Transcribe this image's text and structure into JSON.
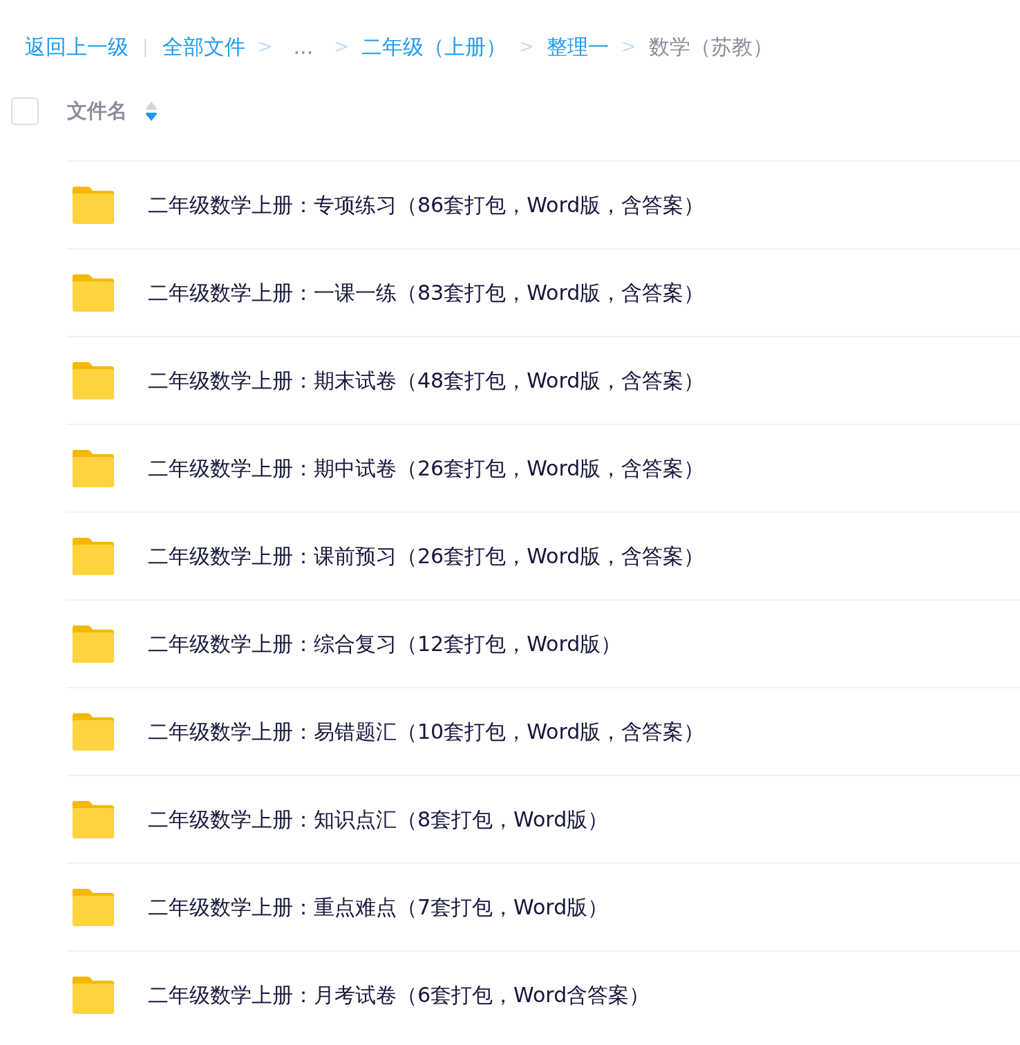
{
  "breadcrumb": [
    {
      "kind": "link",
      "label": "返回上一级"
    },
    {
      "kind": "divider",
      "label": "|"
    },
    {
      "kind": "link",
      "label": "全部文件"
    },
    {
      "kind": "separator",
      "label": ">"
    },
    {
      "kind": "ellipsis",
      "label": "..."
    },
    {
      "kind": "separator",
      "label": ">"
    },
    {
      "kind": "link",
      "label": "二年级（上册）"
    },
    {
      "kind": "separator",
      "label": ">"
    },
    {
      "kind": "link",
      "label": "整理一"
    },
    {
      "kind": "separator",
      "label": ">"
    },
    {
      "kind": "current",
      "label": "数学（苏教）"
    }
  ],
  "header": {
    "checked": false,
    "label": "文件名",
    "sort_descending": true
  },
  "files": [
    {
      "name": "二年级数学上册：专项练习（86套打包，Word版，含答案）"
    },
    {
      "name": "二年级数学上册：一课一练（83套打包，Word版，含答案）"
    },
    {
      "name": "二年级数学上册：期末试卷（48套打包，Word版，含答案）"
    },
    {
      "name": "二年级数学上册：期中试卷（26套打包，Word版，含答案）"
    },
    {
      "name": "二年级数学上册：课前预习（26套打包，Word版，含答案）"
    },
    {
      "name": "二年级数学上册：综合复习（12套打包，Word版）"
    },
    {
      "name": "二年级数学上册：易错题汇（10套打包，Word版，含答案）"
    },
    {
      "name": "二年级数学上册：知识点汇（8套打包，Word版）"
    },
    {
      "name": "二年级数学上册：重点难点（7套打包，Word版）"
    },
    {
      "name": "二年级数学上册：月考试卷（6套打包，Word含答案）"
    }
  ]
}
